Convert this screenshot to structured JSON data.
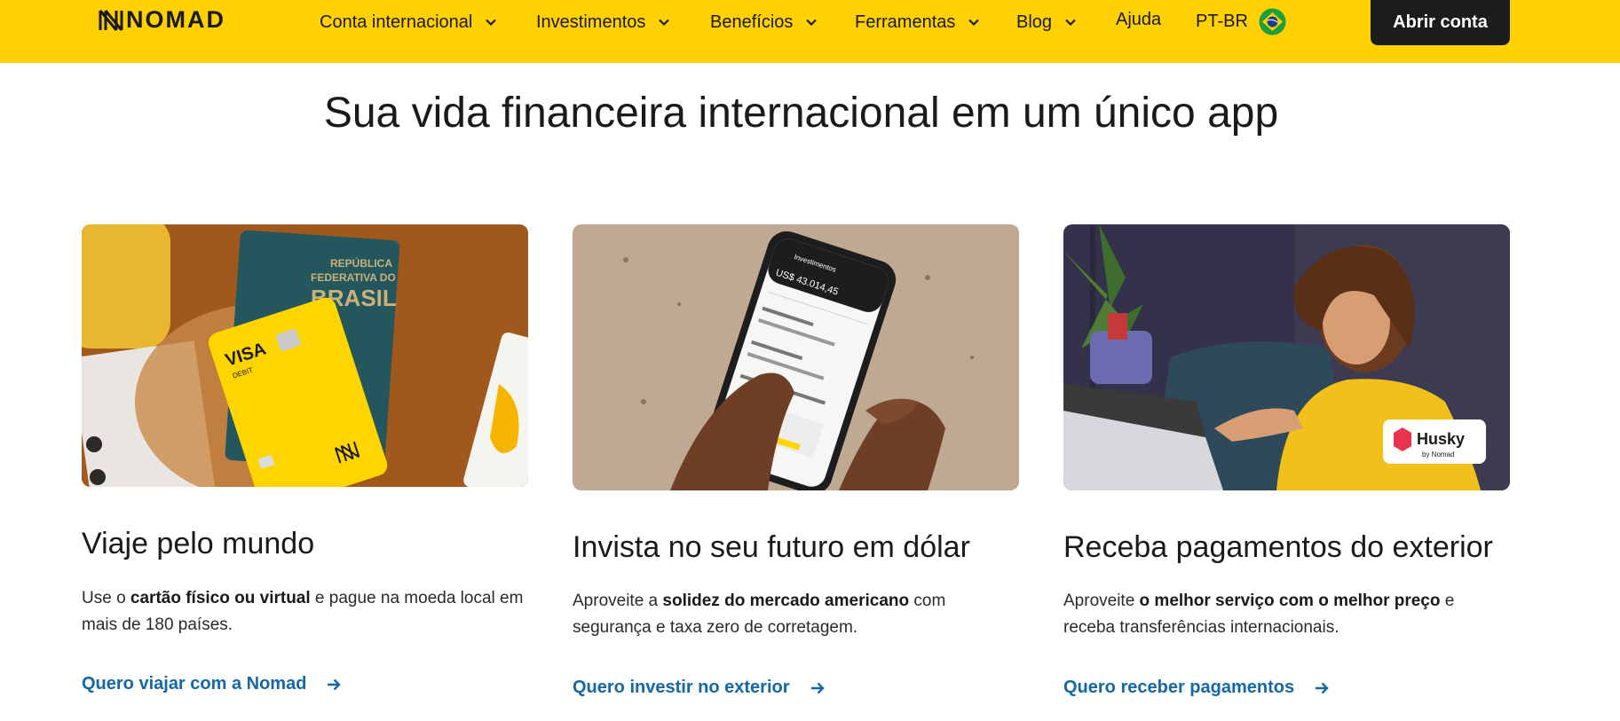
{
  "header": {
    "logo_text": "NOMAD",
    "nav": [
      {
        "label": "Conta internacional"
      },
      {
        "label": "Investimentos"
      },
      {
        "label": "Benefícios"
      },
      {
        "label": "Ferramentas"
      },
      {
        "label": "Blog"
      },
      {
        "label": "Ajuda"
      },
      {
        "label": "PT-BR"
      }
    ],
    "cta_label": "Abrir conta"
  },
  "headline": "Sua vida financeira internacional em um único app",
  "cards": [
    {
      "title": "Viaje pelo mundo",
      "desc_pre": "Use o ",
      "desc_bold": "cartão físico ou virtual",
      "desc_post": " e pague na moeda local em mais de 180 países.",
      "link": "Quero viajar com a Nomad",
      "img": {
        "passport_line1": "REPÚBLICA",
        "passport_line2": "FEDERATIVA DO",
        "passport_line3": "BRASIL",
        "card_brand": "VISA",
        "card_type": "DEBIT"
      }
    },
    {
      "title": "Invista no seu futuro em dólar",
      "desc_pre": "Aproveite a ",
      "desc_bold": "solidez do mercado americano",
      "desc_post": " com segurança e taxa zero de corretagem.",
      "link": "Quero investir no exterior",
      "img": {
        "screen_title": "Investimentos",
        "balance": "US$ 43.014,45"
      }
    },
    {
      "title": "Receba pagamentos do exterior",
      "desc_pre": "Aproveite ",
      "desc_bold": "o melhor serviço com o melhor preço",
      "desc_post": " e receba transferências internacionais.",
      "link": "Quero receber pagamentos",
      "img": {
        "badge_name": "Husky",
        "badge_sub": "by Nomad"
      }
    }
  ],
  "colors": {
    "brand_yellow": "#ffd103",
    "link_blue": "#1667a6",
    "button_dark": "#1c1c1c"
  },
  "icons": [
    "nomad-logo-icon",
    "chevron-down-icon",
    "brazil-flag-icon",
    "arrow-right-icon"
  ]
}
